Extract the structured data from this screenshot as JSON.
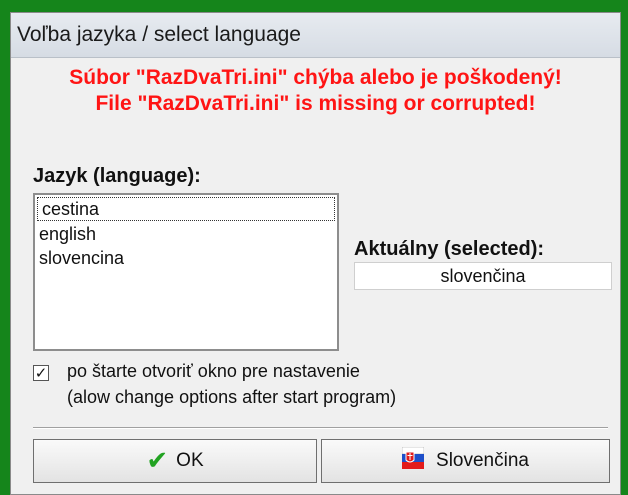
{
  "window": {
    "title": "Voľba jazyka / select language"
  },
  "error": {
    "line1": "Súbor \"RazDvaTri.ini\" chýba alebo je poškodený!",
    "line2": "File \"RazDvaTri.ini\" is missing or corrupted!"
  },
  "language_list": {
    "label": "Jazyk (language):",
    "items": [
      "cestina",
      "english",
      "slovencina"
    ],
    "focused_index": 0
  },
  "selected": {
    "label": "Aktuálny (selected):",
    "value": "slovenčina"
  },
  "option": {
    "checked": true,
    "line1": "po štarte otvoriť okno pre nastavenie",
    "line2": "(alow change options after start program)"
  },
  "buttons": {
    "ok_label": "OK",
    "slovak_label": "Slovenčina",
    "ok_icon": "checkmark-icon",
    "slovak_icon": "slovak-flag-icon"
  },
  "colors": {
    "background": "#15851b",
    "error_text": "#ff1414",
    "check_icon": "#22a322"
  }
}
